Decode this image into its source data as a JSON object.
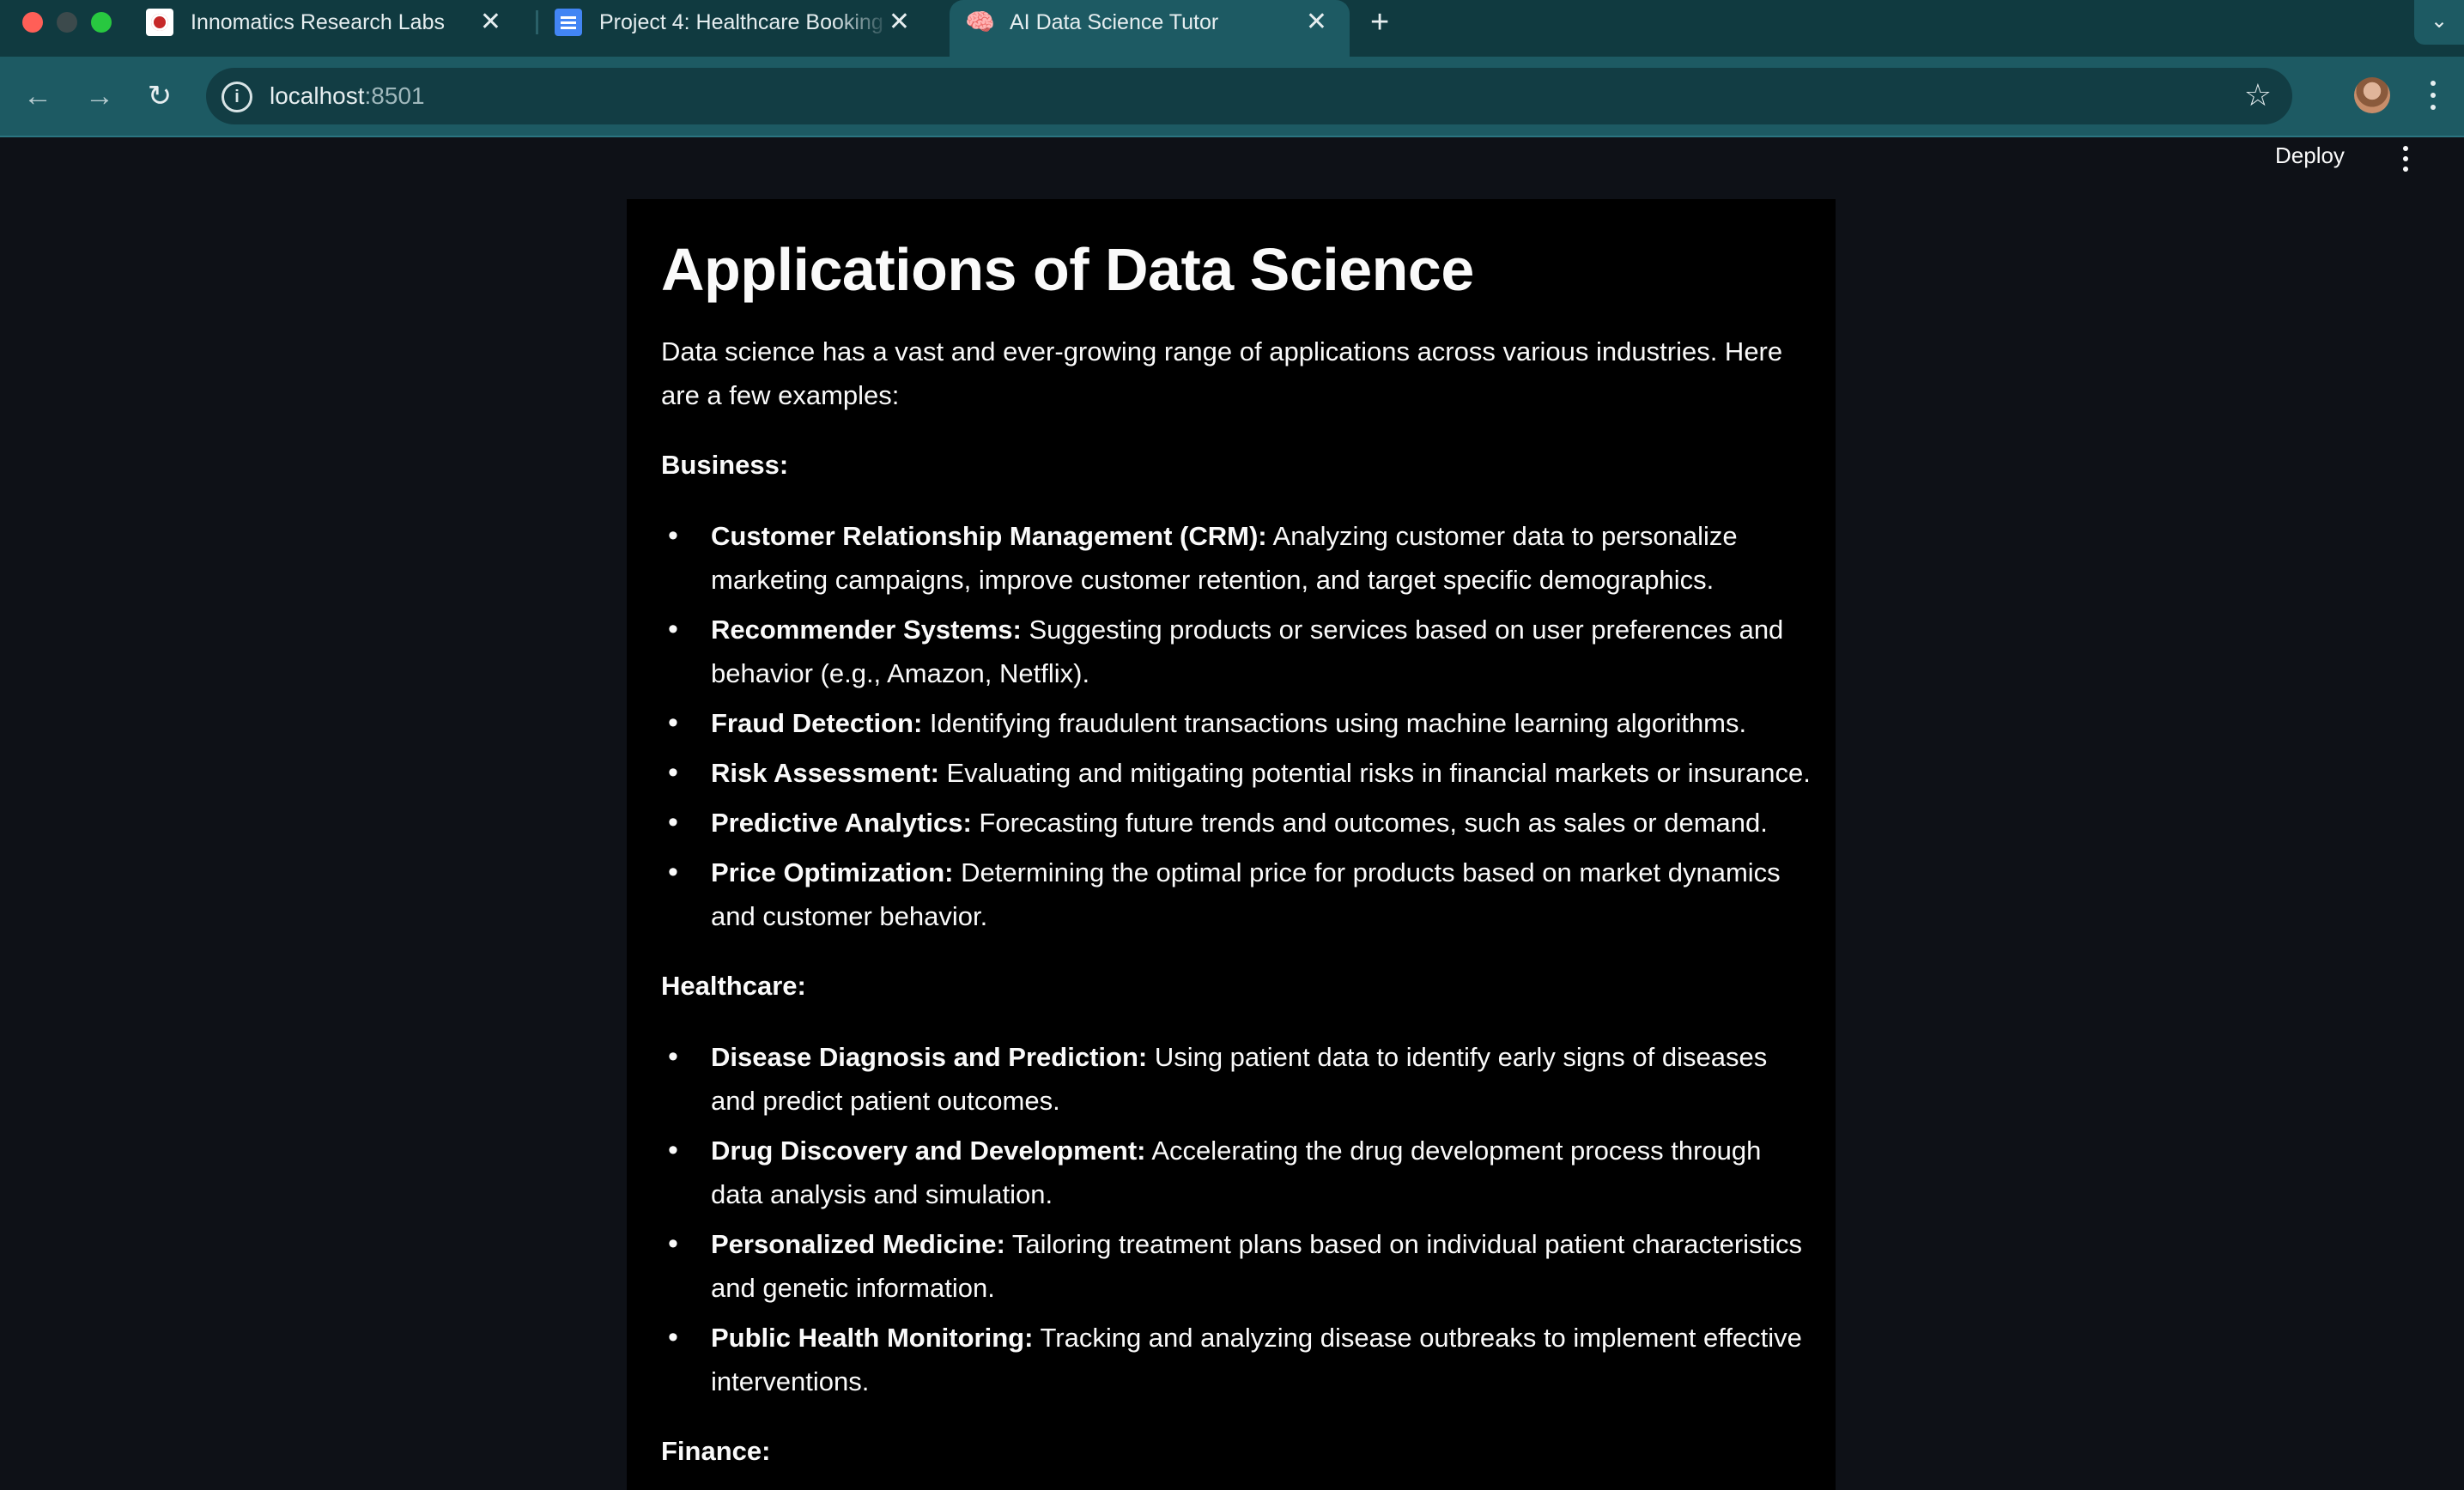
{
  "browser": {
    "tabs": [
      {
        "title": "Innomatics Research Labs",
        "favicon": "innomatics-logo-icon"
      },
      {
        "title": "Project 4: Healthcare Booking",
        "favicon": "google-docs-icon"
      },
      {
        "title": "AI Data Science Tutor",
        "favicon": "brain-icon",
        "active": true
      }
    ],
    "url_host": "localhost",
    "url_port": ":8501",
    "theme_color": "#1d5a63"
  },
  "app_header": {
    "deploy_label": "Deploy"
  },
  "content": {
    "title": "Applications of Data Science",
    "intro": "Data science has a vast and ever-growing range of applications across various industries. Here are a few examples:",
    "sections": [
      {
        "heading": "Business:",
        "items": [
          {
            "term": "Customer Relationship Management (CRM):",
            "text": " Analyzing customer data to personalize marketing campaigns, improve customer retention, and target specific demographics."
          },
          {
            "term": "Recommender Systems:",
            "text": " Suggesting products or services based on user preferences and behavior (e.g., Amazon, Netflix)."
          },
          {
            "term": "Fraud Detection:",
            "text": " Identifying fraudulent transactions using machine learning algorithms."
          },
          {
            "term": "Risk Assessment:",
            "text": " Evaluating and mitigating potential risks in financial markets or insurance."
          },
          {
            "term": "Predictive Analytics:",
            "text": " Forecasting future trends and outcomes, such as sales or demand."
          },
          {
            "term": "Price Optimization:",
            "text": " Determining the optimal price for products based on market dynamics and customer behavior."
          }
        ]
      },
      {
        "heading": "Healthcare:",
        "items": [
          {
            "term": "Disease Diagnosis and Prediction:",
            "text": " Using patient data to identify early signs of diseases and predict patient outcomes."
          },
          {
            "term": "Drug Discovery and Development:",
            "text": " Accelerating the drug development process through data analysis and simulation."
          },
          {
            "term": "Personalized Medicine:",
            "text": " Tailoring treatment plans based on individual patient characteristics and genetic information."
          },
          {
            "term": "Public Health Monitoring:",
            "text": " Tracking and analyzing disease outbreaks to implement effective interventions."
          }
        ]
      },
      {
        "heading": "Finance:",
        "items": []
      }
    ]
  }
}
